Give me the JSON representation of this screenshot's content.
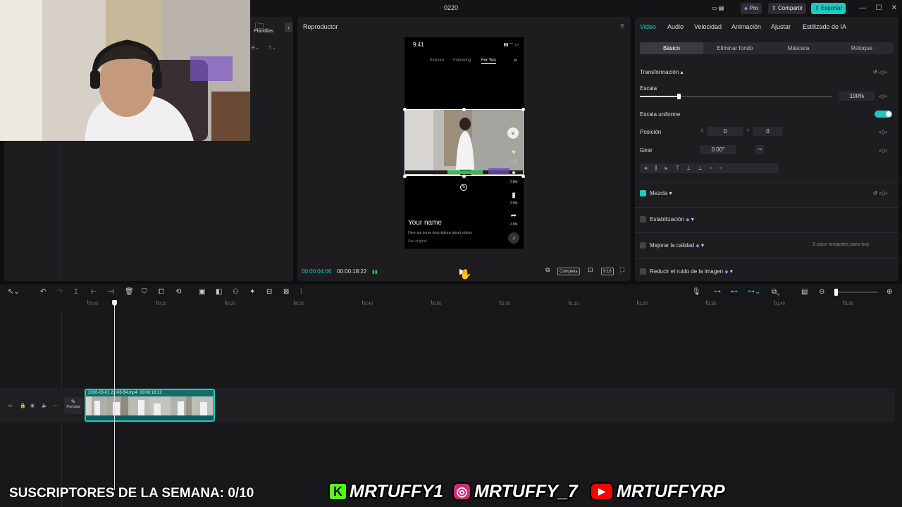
{
  "window": {
    "title": "0220",
    "pro_label": "Pro",
    "share_label": "Compartir",
    "export_label": "Exportar"
  },
  "left_panel": {
    "templates_label": "Plantillas"
  },
  "player": {
    "title": "Reproductor",
    "phone": {
      "clock": "9:41",
      "nav": [
        "Explore",
        "Following",
        "For You"
      ],
      "like_count": "2.8M",
      "comment_count": "2.8M",
      "save_count": "2.8M",
      "share_count": "2.8M",
      "username": "Your name",
      "description": "Here are some descriptions about videos",
      "see_original": "See original"
    },
    "current_time": "00:00:04:06",
    "total_time": "00:00:18:22",
    "complete_label": "Completa",
    "ratio_label": "9:16"
  },
  "properties": {
    "tabs": [
      "Video",
      "Audio",
      "Velocidad",
      "Animación",
      "Ajustar",
      "Estilizado de IA"
    ],
    "active_tab": "Video",
    "subtabs": [
      "Básico",
      "Eliminar fondo",
      "Máscara",
      "Retoque"
    ],
    "transform_label": "Transformación",
    "scale_label": "Escala",
    "scale_value": "100%",
    "scale_fraction": 0.2,
    "uniform_scale_label": "Escala uniforme",
    "position_label": "Posición",
    "pos_x_label": "X",
    "pos_x": "0",
    "pos_y_label": "Y",
    "pos_y": "0",
    "rotate_label": "Girar",
    "rotate_value": "0.00°",
    "blend_label": "Mezcla",
    "stabilize_label": "Estabilización",
    "quality_label": "Mejorar la calidad",
    "quality_note": "3 usos restantes para hoy",
    "noise_label": "Reducir el ruido de la imagen"
  },
  "timeline": {
    "ticks": [
      "00:00",
      "00:10",
      "00:20",
      "00:30",
      "00:40",
      "00:50",
      "01:00",
      "01:10",
      "01:20",
      "01:30",
      "01:40",
      "01:50"
    ],
    "clip_name": "2026-03-01 22-08-54.mp4",
    "clip_duration": "00:00:18:22",
    "cover_label": "Portada"
  },
  "overlay": {
    "subs_text": "SUSCRIPTORES DE LA SEMANA: 0/10",
    "kick_icon": "K",
    "kick_handle": "MRTUFFY1",
    "instagram_handle": "MRTUFFY_7",
    "youtube_handle": "MRTUFFYRP"
  },
  "colors": {
    "accent": "#1ec9c0",
    "kick": "#53fc18",
    "youtube": "#ff0000",
    "instagram": "#d62976"
  }
}
